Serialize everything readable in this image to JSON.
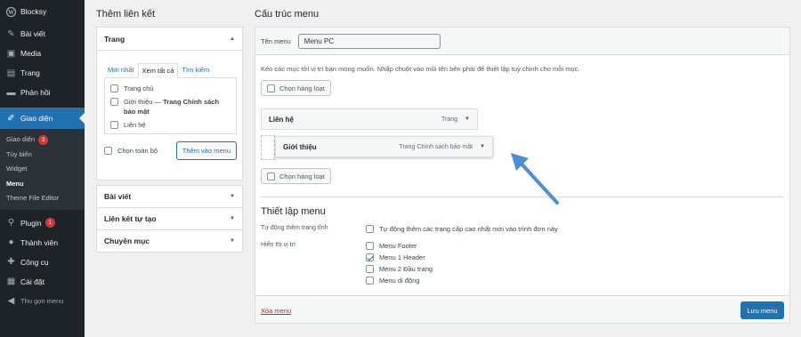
{
  "sidebar": {
    "brand": "Blocksy",
    "items": [
      {
        "label": "Bài viết",
        "icon": "pin-icon"
      },
      {
        "label": "Media",
        "icon": "media-icon"
      },
      {
        "label": "Trang",
        "icon": "page-icon"
      },
      {
        "label": "Phản hồi",
        "icon": "comment-icon"
      }
    ],
    "active": {
      "label": "Giao diện",
      "icon": "brush-icon"
    },
    "submenu": [
      {
        "label": "Giao diện",
        "badge": "3"
      },
      {
        "label": "Tùy biến"
      },
      {
        "label": "Widget"
      },
      {
        "label": "Menu"
      },
      {
        "label": "Theme File Editor"
      }
    ],
    "items2": [
      {
        "label": "Plugin",
        "icon": "plugin-icon",
        "badge": "1"
      },
      {
        "label": "Thành viên",
        "icon": "user-icon"
      },
      {
        "label": "Công cụ",
        "icon": "wrench-icon"
      },
      {
        "label": "Cài đặt",
        "icon": "settings-icon"
      }
    ],
    "collapse": "Thu gọn menu"
  },
  "left": {
    "title": "Thêm liên kết",
    "pages_panel": {
      "title": "Trang",
      "tabs": [
        "Mới nhất",
        "Xem tất cả",
        "Tìm kiếm"
      ],
      "items": [
        {
          "label": "Trang chủ",
          "suffix": ""
        },
        {
          "label": "Giới thiệu — ",
          "suffix": "Trang Chính sách bảo mật"
        },
        {
          "label": "Liên hệ",
          "suffix": ""
        }
      ],
      "select_all": "Chọn toàn bộ",
      "add_button": "Thêm vào menu"
    },
    "accordions": [
      "Bài viết",
      "Liên kết tự tạo",
      "Chuyên mục"
    ]
  },
  "right": {
    "title": "Cấu trúc menu",
    "menu_name_label": "Tên menu",
    "menu_name_value": "Menu PC",
    "instructions": "Kéo các mục tới vị trí bạn mong muốn. Nhấp chuột vào mũi tên bên phải để thiết lập tuỳ chỉnh cho mỗi mục.",
    "bulk_select": "Chọn hàng loạt",
    "menu_items": [
      {
        "label": "Liên hệ",
        "type": "Trang"
      },
      {
        "label": "Giới thiệu",
        "type": "Trang Chính sách bảo mật"
      }
    ],
    "settings": {
      "title": "Thiết lập menu",
      "auto_add_label": "Tự động thêm trang tĩnh",
      "auto_add_option": "Tự động thêm các trang cấp cao nhất mới vào trình đơn này",
      "location_label": "Hiển thị vị trí",
      "locations": [
        {
          "label": "Menu Footer",
          "checked": false
        },
        {
          "label": "Menu 1 Header",
          "checked": true
        },
        {
          "label": "Menu 2 Đầu trang",
          "checked": false
        },
        {
          "label": "Menu di động",
          "checked": false
        }
      ]
    },
    "delete_link": "Xóa menu",
    "save_button": "Lưu menu"
  },
  "colors": {
    "accent": "#2271b1",
    "arrow": "#4a90d9",
    "sidebar": "#1d2327"
  }
}
